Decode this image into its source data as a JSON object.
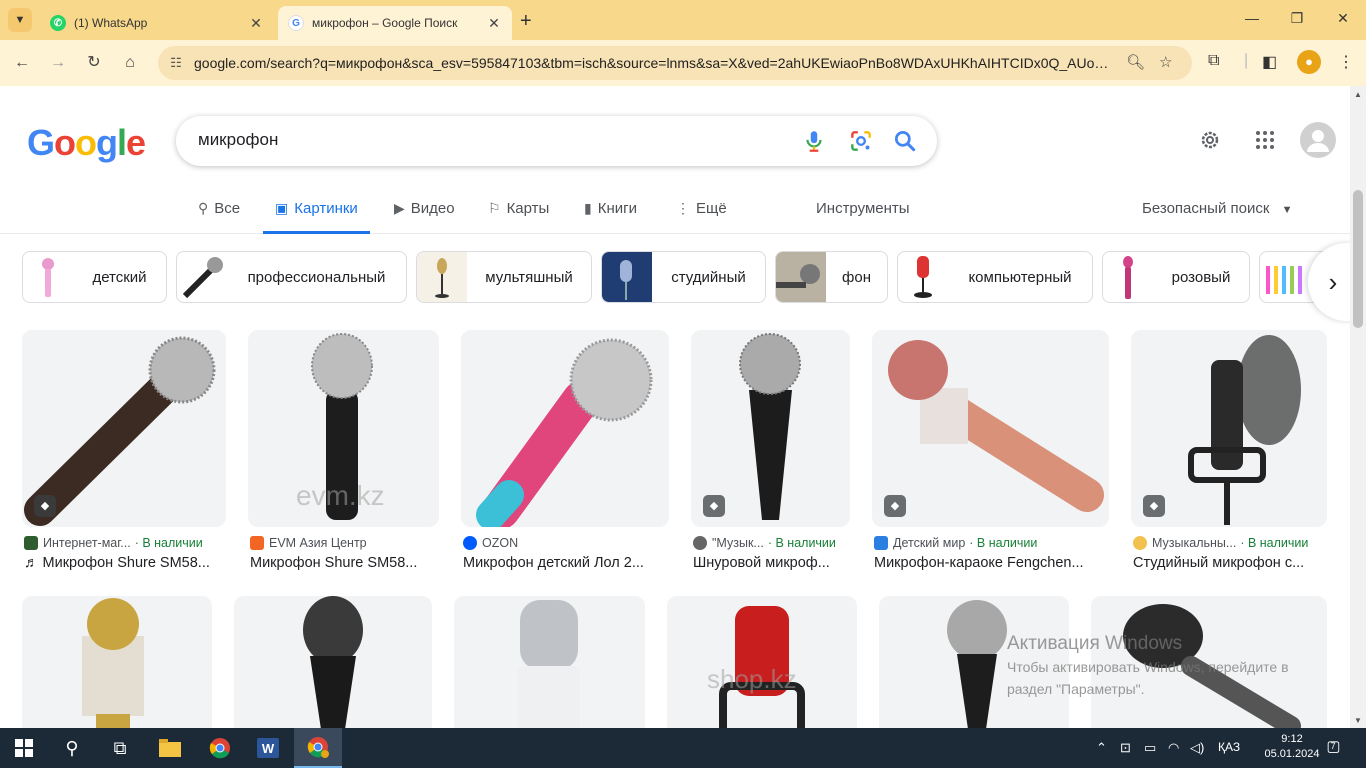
{
  "browser": {
    "tabs": [
      {
        "title": "(1) WhatsApp",
        "close": "✕"
      },
      {
        "title": "микрофон – Google Поиск",
        "close": "✕"
      }
    ],
    "new_tab": "+",
    "url": "google.com/search?q=микрофон&sca_esv=595847103&tbm=isch&source=lnms&sa=X&ved=2ahUKEwiaoPnBo8WDAxUHKhAIHTCIDx0Q_AUoAXo...",
    "window_controls": [
      "—",
      "❐",
      "✕"
    ]
  },
  "logo": {
    "g1": "G",
    "o1": "o",
    "o2": "o",
    "g2": "g",
    "l": "l",
    "e": "e"
  },
  "search": {
    "value": "микрофон"
  },
  "nav_tabs": [
    {
      "label": "Все",
      "icon": "search-icon"
    },
    {
      "label": "Картинки",
      "icon": "image-icon"
    },
    {
      "label": "Видео",
      "icon": "video-icon"
    },
    {
      "label": "Карты",
      "icon": "map-pin-icon"
    },
    {
      "label": "Книги",
      "icon": "book-icon"
    },
    {
      "label": "Ещё",
      "icon": "more-vert-icon"
    }
  ],
  "tools_label": "Инструменты",
  "safe_search_label": "Безопасный поиск",
  "chips": [
    {
      "label": "детский"
    },
    {
      "label": "профессиональный"
    },
    {
      "label": "мультяшный"
    },
    {
      "label": "студийный"
    },
    {
      "label": "фон"
    },
    {
      "label": "компьютерный"
    },
    {
      "label": "розовый"
    }
  ],
  "results": [
    {
      "source": "Интернет-маг...",
      "stock": "· В наличии",
      "caption": "♬ Микрофон Shure SM58..."
    },
    {
      "source": "EVM Азия Центр",
      "stock": "",
      "caption": "Микрофон Shure SM58...",
      "watermark": "evm.kz"
    },
    {
      "source": "OZON",
      "stock": "",
      "caption": "Микрофон детский Лол 2..."
    },
    {
      "source": "\"Музык...",
      "stock": "· В наличии",
      "caption": "Шнуровой микроф..."
    },
    {
      "source": "Детский мир",
      "stock": "· В наличии",
      "caption": "Микрофон-караоке Fengchen..."
    },
    {
      "source": "Музыкальны...",
      "stock": "· В наличии",
      "caption": "Студийный микрофон с..."
    }
  ],
  "row2_watermark": "shop.kz",
  "activation": {
    "title": "Активация Windows",
    "line1": "Чтобы активировать Windows, перейдите в",
    "line2": "раздел \"Параметры\"."
  },
  "taskbar": {
    "language": "ҚАЗ",
    "time": "9:12",
    "date": "05.01.2024",
    "notifications": "7"
  },
  "colors": {
    "accent": "#1a73e8",
    "in_stock": "#188038",
    "chrome_tab": "#f8d98b",
    "chrome_toolbar": "#fff3d6"
  }
}
